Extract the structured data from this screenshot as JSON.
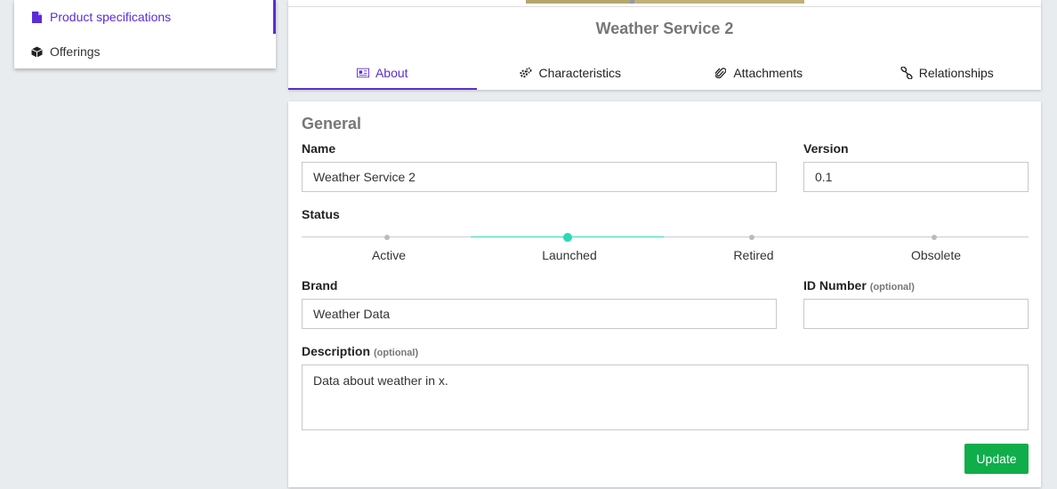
{
  "sidebar": {
    "items": [
      {
        "label": "Product specifications",
        "icon": "file-icon",
        "active": true
      },
      {
        "label": "Offerings",
        "icon": "cube-icon",
        "active": false
      }
    ]
  },
  "header": {
    "title": "Weather Service 2",
    "tabs": [
      {
        "label": "About",
        "icon": "newspaper-icon",
        "active": true
      },
      {
        "label": "Characteristics",
        "icon": "gears-icon",
        "active": false
      },
      {
        "label": "Attachments",
        "icon": "paperclip-icon",
        "active": false
      },
      {
        "label": "Relationships",
        "icon": "link-icon",
        "active": false
      }
    ]
  },
  "form": {
    "section_title": "General",
    "name": {
      "label": "Name",
      "value": "Weather Service 2"
    },
    "version": {
      "label": "Version",
      "value": "0.1"
    },
    "status": {
      "label": "Status",
      "options": [
        "Active",
        "Launched",
        "Retired",
        "Obsolete"
      ],
      "selected": "Launched"
    },
    "brand": {
      "label": "Brand",
      "value": "Weather Data"
    },
    "id_number": {
      "label": "ID Number",
      "optional": "(optional)",
      "value": ""
    },
    "description": {
      "label": "Description",
      "optional": "(optional)",
      "value": "Data about weather in x."
    },
    "update_label": "Update"
  },
  "colors": {
    "accent": "#5b2dd6",
    "status_active": "#2bd9b4",
    "update_button": "#10ad4b"
  }
}
